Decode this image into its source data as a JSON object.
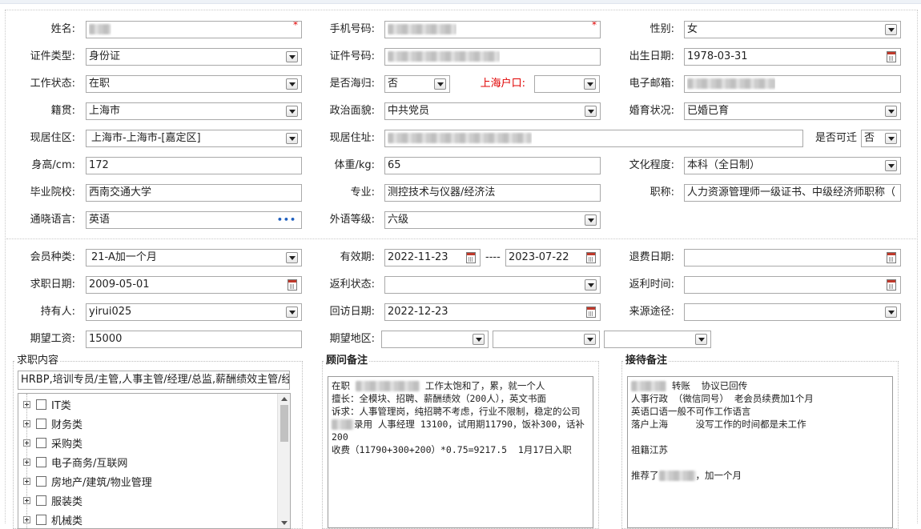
{
  "basic": {
    "name_label": "姓名:",
    "phone_label": "手机号码:",
    "gender_label": "性别:",
    "gender_value": "女",
    "idtype_label": "证件类型:",
    "idtype_value": "身份证",
    "idno_label": "证件号码:",
    "birth_label": "出生日期:",
    "birth_value": "1978-03-31",
    "workstatus_label": "工作状态:",
    "workstatus_value": "在职",
    "returnee_label": "是否海归:",
    "returnee_value": "否",
    "hukou_label": "上海户口:",
    "hukou_value": "",
    "email_label": "电子邮箱:",
    "native_label": "籍贯:",
    "native_value": "上海市",
    "political_label": "政治面貌:",
    "political_value": "中共党员",
    "marital_label": "婚育状况:",
    "marital_value": "已婚已育",
    "district_label": "现居住区:",
    "district_value": "上海市-上海市-[嘉定区]",
    "address_label": "现居住址:",
    "relocate_label": "是否可迁",
    "relocate_value": "否",
    "height_label": "身高/cm:",
    "height_value": "172",
    "weight_label": "体重/kg:",
    "weight_value": "65",
    "education_label": "文化程度:",
    "education_value": "本科（全日制）",
    "school_label": "毕业院校:",
    "school_value": "西南交通大学",
    "major_label": "专业:",
    "major_value": "测控技术与仪器/经济法",
    "title_label": "职称:",
    "title_value": "人力资源管理师一级证书、中级经济师职称（",
    "language_label": "通晓语言:",
    "language_value": "英语",
    "langlevel_label": "外语等级:",
    "langlevel_value": "六级",
    "required_mark": "*"
  },
  "member": {
    "type_label": "会员种类:",
    "type_value": "21-A加一个月",
    "valid_label": "有效期:",
    "valid_from": "2022-11-23",
    "valid_sep": "----",
    "valid_to": "2023-07-22",
    "refund_label": "退费日期:",
    "refund_value": "",
    "jobdate_label": "求职日期:",
    "jobdate_value": "2009-05-01",
    "rebate_label": "返利状态:",
    "rebate_value": "",
    "rebatetime_label": "返利时间:",
    "rebatetime_value": "",
    "holder_label": "持有人:",
    "holder_value": "yirui025",
    "visit_label": "回访日期:",
    "visit_value": "2022-12-23",
    "source_label": "来源途径:",
    "source_value": "",
    "salary_label": "期望工资:",
    "salary_value": "15000",
    "region_label": "期望地区:"
  },
  "job": {
    "legend": "求职内容",
    "summary": "HRBP,培训专员/主管,人事主管/经理/总监,薪酬绩效主管/经",
    "categories": [
      "IT类",
      "财务类",
      "采购类",
      "电子商务/互联网",
      "房地产/建筑/物业管理",
      "服装类",
      "机械类"
    ]
  },
  "advisor": {
    "legend": "顾问备注",
    "line1_pre": "在职 ",
    "line1_post": " 工作太饱和了，累，就一个人",
    "line2": "擅长：全模块、招聘、薪酬绩效（200人），英文书面",
    "line3": "诉求：人事管理岗，纯招聘不考虑，行业不限制，稳定的公司",
    "line4_post": "录用 人事经理 13100，试用期11790，饭补300，话补200",
    "line5": "收费（11790+300+200）*0.75=9217.5  1月17日入职"
  },
  "reception": {
    "legend": "接待备注",
    "line1_post": " 转账  协议已回传",
    "line2": "人事行政 （微信同号） 老会员续费加1个月",
    "line3": "英语口语一般不可作工作语言",
    "line4": "落户上海     没写工作的时间都是未工作",
    "line5": "祖籍江苏",
    "line6_pre": "推荐了",
    "line6_post": "，加一个月"
  }
}
